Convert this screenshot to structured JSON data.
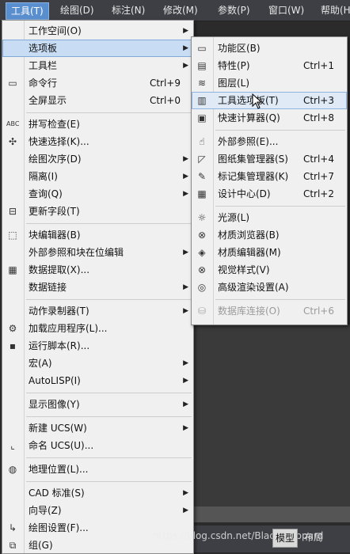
{
  "menubar": {
    "items": [
      "工具(T)",
      "绘图(D)",
      "标注(N)",
      "修改(M)",
      "参数(P)",
      "窗口(W)",
      "帮助(H"
    ]
  },
  "tools_menu": {
    "items": [
      {
        "label": "工作空间(O)",
        "shortcut": "",
        "submenu": true,
        "icon": ""
      },
      {
        "label": "选项板",
        "shortcut": "",
        "submenu": true,
        "icon": ""
      },
      {
        "label": "工具栏",
        "shortcut": "",
        "submenu": true,
        "icon": ""
      },
      {
        "label": "命令行",
        "shortcut": "Ctrl+9",
        "submenu": false,
        "icon": "command-line-icon"
      },
      {
        "label": "全屏显示",
        "shortcut": "Ctrl+0",
        "submenu": false,
        "icon": ""
      },
      {
        "label": "拼写检查(E)",
        "shortcut": "",
        "submenu": false,
        "icon": "spell-check-icon"
      },
      {
        "label": "快速选择(K)...",
        "shortcut": "",
        "submenu": false,
        "icon": "quick-select-icon"
      },
      {
        "label": "绘图次序(D)",
        "shortcut": "",
        "submenu": true,
        "icon": ""
      },
      {
        "label": "隔离(I)",
        "shortcut": "",
        "submenu": true,
        "icon": ""
      },
      {
        "label": "查询(Q)",
        "shortcut": "",
        "submenu": true,
        "icon": ""
      },
      {
        "label": "更新字段(T)",
        "shortcut": "",
        "submenu": false,
        "icon": "update-field-icon"
      },
      {
        "label": "块编辑器(B)",
        "shortcut": "",
        "submenu": false,
        "icon": "block-editor-icon"
      },
      {
        "label": "外部参照和块在位编辑",
        "shortcut": "",
        "submenu": true,
        "icon": ""
      },
      {
        "label": "数据提取(X)...",
        "shortcut": "",
        "submenu": false,
        "icon": "data-extraction-icon"
      },
      {
        "label": "数据链接",
        "shortcut": "",
        "submenu": true,
        "icon": ""
      },
      {
        "label": "动作录制器(T)",
        "shortcut": "",
        "submenu": true,
        "icon": ""
      },
      {
        "label": "加载应用程序(L)...",
        "shortcut": "",
        "submenu": false,
        "icon": "load-application-icon"
      },
      {
        "label": "运行脚本(R)...",
        "shortcut": "",
        "submenu": false,
        "icon": "run-script-icon"
      },
      {
        "label": "宏(A)",
        "shortcut": "",
        "submenu": true,
        "icon": ""
      },
      {
        "label": "AutoLISP(I)",
        "shortcut": "",
        "submenu": true,
        "icon": ""
      },
      {
        "label": "显示图像(Y)",
        "shortcut": "",
        "submenu": true,
        "icon": ""
      },
      {
        "label": "新建 UCS(W)",
        "shortcut": "",
        "submenu": true,
        "icon": ""
      },
      {
        "label": "命名 UCS(U)...",
        "shortcut": "",
        "submenu": false,
        "icon": "named-ucs-icon"
      },
      {
        "label": "地理位置(L)...",
        "shortcut": "",
        "submenu": false,
        "icon": "globe-icon"
      },
      {
        "label": "CAD 标准(S)",
        "shortcut": "",
        "submenu": true,
        "icon": ""
      },
      {
        "label": "向导(Z)",
        "shortcut": "",
        "submenu": true,
        "icon": ""
      },
      {
        "label": "绘图设置(F)...",
        "shortcut": "",
        "submenu": false,
        "icon": "drafting-settings-icon"
      },
      {
        "label": "组(G)",
        "shortcut": "",
        "submenu": false,
        "icon": "group-icon"
      }
    ]
  },
  "palettes_submenu": {
    "items": [
      {
        "label": "功能区(B)",
        "shortcut": "",
        "icon": "ribbon-icon"
      },
      {
        "label": "特性(P)",
        "shortcut": "Ctrl+1",
        "icon": "properties-icon"
      },
      {
        "label": "图层(L)",
        "shortcut": "",
        "icon": "layers-icon"
      },
      {
        "label": "工具选项板(T)",
        "shortcut": "Ctrl+3",
        "icon": "tool-palettes-icon"
      },
      {
        "label": "快速计算器(Q)",
        "shortcut": "Ctrl+8",
        "icon": "calculator-icon"
      },
      {
        "label": "外部参照(E)...",
        "shortcut": "",
        "icon": "external-references-icon"
      },
      {
        "label": "图纸集管理器(S)",
        "shortcut": "Ctrl+4",
        "icon": "sheet-set-manager-icon"
      },
      {
        "label": "标记集管理器(K)",
        "shortcut": "Ctrl+7",
        "icon": "markup-set-manager-icon"
      },
      {
        "label": "设计中心(D)",
        "shortcut": "Ctrl+2",
        "icon": "design-center-icon"
      },
      {
        "label": "光源(L)",
        "shortcut": "",
        "icon": "lights-icon"
      },
      {
        "label": "材质浏览器(B)",
        "shortcut": "",
        "icon": "materials-browser-icon"
      },
      {
        "label": "材质编辑器(M)",
        "shortcut": "",
        "icon": "materials-editor-icon"
      },
      {
        "label": "视觉样式(V)",
        "shortcut": "",
        "icon": "visual-styles-icon"
      },
      {
        "label": "高级渲染设置(A)",
        "shortcut": "",
        "icon": "render-settings-icon"
      },
      {
        "label": "数据库连接(O)",
        "shortcut": "Ctrl+6",
        "icon": "database-connection-icon",
        "disabled": true
      }
    ]
  },
  "status": {
    "watermark": "https://blog.csdn.net/Black_Leopard",
    "model_tab": "模型",
    "layout_tab": "布局"
  }
}
